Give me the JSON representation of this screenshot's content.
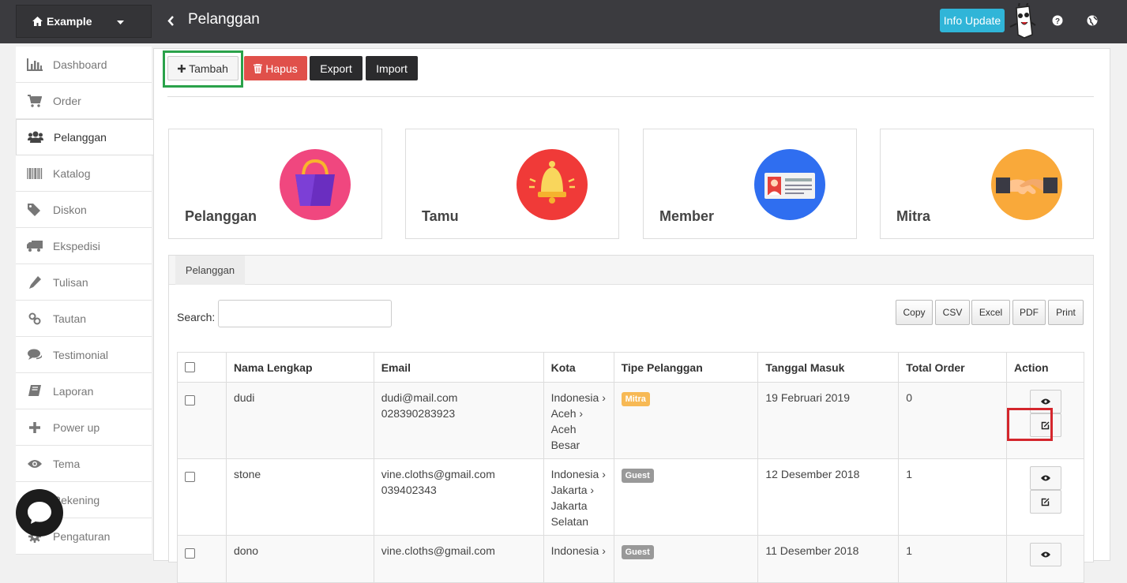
{
  "topbar": {
    "store_name": "Example",
    "page_title": "Pelanggan",
    "info_update": "Info Update"
  },
  "sidebar": {
    "items": [
      {
        "label": "Dashboard",
        "icon": "bar-chart-icon"
      },
      {
        "label": "Order",
        "icon": "cart-icon"
      },
      {
        "label": "Pelanggan",
        "icon": "users-icon",
        "active": true
      },
      {
        "label": "Katalog",
        "icon": "barcode-icon"
      },
      {
        "label": "Diskon",
        "icon": "tags-icon"
      },
      {
        "label": "Ekspedisi",
        "icon": "truck-icon"
      },
      {
        "label": "Tulisan",
        "icon": "pencil-icon"
      },
      {
        "label": "Tautan",
        "icon": "link-icon"
      },
      {
        "label": "Testimonial",
        "icon": "comments-icon"
      },
      {
        "label": "Laporan",
        "icon": "book-icon"
      },
      {
        "label": "Power up",
        "icon": "plus-icon"
      },
      {
        "label": "Tema",
        "icon": "eye-icon"
      },
      {
        "label": "Rekening",
        "icon": "bank-icon"
      },
      {
        "label": "Pengaturan",
        "icon": "gear-icon"
      }
    ]
  },
  "toolbar": {
    "add_label": "Tambah",
    "delete_label": "Hapus",
    "export_label": "Export",
    "import_label": "Import"
  },
  "cards": [
    {
      "label": "Pelanggan",
      "icon": "shopping-bag-icon",
      "color": "#f0477f"
    },
    {
      "label": "Tamu",
      "icon": "bell-icon",
      "color": "#f03a38"
    },
    {
      "label": "Member",
      "icon": "id-card-icon",
      "color": "#2f6ef0"
    },
    {
      "label": "Mitra",
      "icon": "handshake-icon",
      "color": "#f9a93a"
    }
  ],
  "panel": {
    "tab_label": "Pelanggan",
    "search_label": "Search:",
    "export_buttons": [
      "Copy",
      "CSV",
      "Excel",
      "PDF",
      "Print"
    ]
  },
  "table": {
    "headers": [
      "Nama Lengkap",
      "Email",
      "Kota",
      "Tipe Pelanggan",
      "Tanggal Masuk",
      "Total Order",
      "Action"
    ],
    "rows": [
      {
        "name": "dudi",
        "email": "dudi@mail.com",
        "phone": "028390283923",
        "kota": [
          "Indonesia ›",
          "Aceh ›",
          "Aceh",
          "Besar"
        ],
        "tipe": "Mitra",
        "tipe_color": "#f7b955",
        "tanggal": "19 Februari 2019",
        "total": "0"
      },
      {
        "name": "stone",
        "email": "vine.cloths@gmail.com",
        "phone": "039402343",
        "kota": [
          "Indonesia ›",
          "Jakarta ›",
          "Jakarta",
          "Selatan"
        ],
        "tipe": "Guest",
        "tipe_color": "#999999",
        "tanggal": "12 Desember 2018",
        "total": "1"
      },
      {
        "name": "dono",
        "email": "vine.cloths@gmail.com",
        "phone": "",
        "kota": [
          "Indonesia ›"
        ],
        "tipe": "Guest",
        "tipe_color": "#999999",
        "tanggal": "11 Desember 2018",
        "total": "1"
      }
    ]
  }
}
